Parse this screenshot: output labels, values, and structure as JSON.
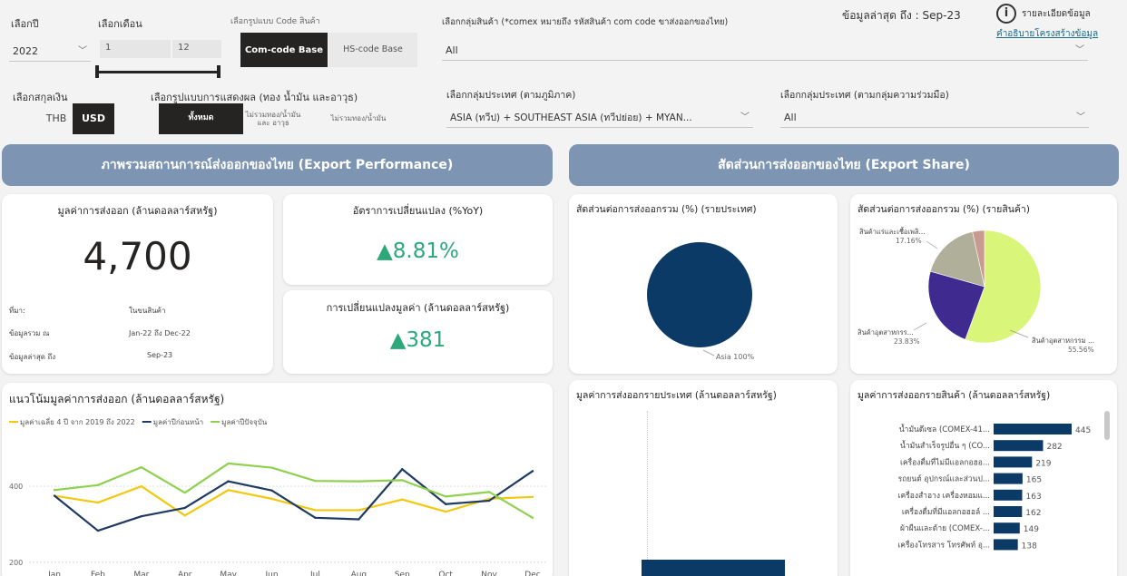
{
  "filters": {
    "year_label": "เลือกปี",
    "year_value": "2022",
    "month_label": "เลือกเดือน",
    "month_from": "1",
    "month_to": "12",
    "code_type_label": "เลือกรูปแบบ Code สินค้า",
    "code_btn_active": "Com-code Base",
    "code_btn_inactive": "HS-code Base",
    "product_group_label": "เลือกกลุ่มสินค้า (*comex หมายถึง รหัสสินค้า com code ขาส่งออกของไทย)",
    "product_group_value": "All",
    "latest_data_label": "ข้อมูลล่าสุด ถึง : Sep-23",
    "detail_label": "รายละเอียดข้อมูล",
    "structure_link": "คำอธิบายโครงสร้างข้อมูล",
    "currency_label": "เลือกสกุลเงิน",
    "currency_thb": "THB",
    "currency_usd": "USD",
    "display_label": "เลือกรูปแบบการแสดงผล (ทอง น้ำมัน และอาวุธ)",
    "display_all": "ทั้งหมด",
    "display_opt2": "ไม่รวมทอง/น้ำมัน และ อาวุธ",
    "display_opt3": "ไม่รวมทอง/น้ำมัน",
    "region_label": "เลือกกลุ่มประเทศ (ตามภูมิภาค)",
    "region_value": "ASIA (ทวีป) + SOUTHEAST ASIA (ทวีปย่อย) + MYAN...",
    "coop_label": "เลือกกลุ่มประเทศ (ตามกลุ่มความร่วมมือ)",
    "coop_value": "All"
  },
  "banners": {
    "performance": "ภาพรวมสถานการณ์ส่งออกของไทย (Export Performance)",
    "share": "สัดส่วนการส่งออกของไทย (Export Share)"
  },
  "export_value": {
    "title": "มูลค่าการส่งออก (ล้านดอลลาร์สหรัฐ)",
    "value": "4,700",
    "source_label": "ที่มา:",
    "source_value": "ในขนสินค้า",
    "range_label": "ข้อมูลรวม ณ",
    "range_value": "Jan-22 ถึง Dec-22",
    "latest_label": "ข้อมูลล่าสุด ถึง",
    "latest_value": "Sep-23"
  },
  "yoy": {
    "title": "อัตราการเปลี่ยนแปลง (%YoY)",
    "value": "▲8.81%"
  },
  "change": {
    "title": "การเปลี่ยนแปลงมูลค่า (ล้านดอลลาร์สหรัฐ)",
    "value": "▲381"
  },
  "share_country": {
    "title": "สัดส่วนต่อการส่งออกรวม (%) (รายประเทศ)",
    "label": "Asia 100%"
  },
  "share_product": {
    "title": "สัดส่วนต่อการส่งออกรวม (%) (รายสินค้า)",
    "slices": [
      {
        "name": "สินค้าอุตสาหกรรม ...",
        "value": 55.56,
        "label": "55.56%",
        "color": "#d9f57a"
      },
      {
        "name": "สินค้าอุตสาหกรร...",
        "value": 23.83,
        "label": "23.83%",
        "color": "#3f2a8f"
      },
      {
        "name": "สินค้าแร่และเชื้อเพลิ...",
        "value": 17.16,
        "label": "17.16%",
        "color": "#b0b09a"
      },
      {
        "name": "",
        "value": 3.45,
        "label": "",
        "color": "#c99a8f"
      }
    ]
  },
  "trend": {
    "title": "แนวโน้มมูลค่าการส่งออก (ล้านดอลลาร์สหรัฐ)",
    "legend": [
      {
        "name": "มูลค่าเฉลี่ย 4 ปี จาก 2019 ถึง 2022",
        "color": "#f2c811"
      },
      {
        "name": "มูลค่าปีก่อนหน้า",
        "color": "#1f3a63"
      },
      {
        "name": "มูลค่าปีปัจจุบัน",
        "color": "#8fd14f"
      }
    ]
  },
  "country_bar": {
    "title": "มูลค่าการส่งออกรายประเทศ (ล้านดอลลาร์สหรัฐ)"
  },
  "product_bar": {
    "title": "มูลค่าการส่งออกรายสินค้า (ล้านดอลลาร์สหรัฐ)"
  },
  "chart_data": [
    {
      "type": "line",
      "title": "แนวโน้มมูลค่าการส่งออก (ล้านดอลลาร์สหรัฐ)",
      "categories": [
        "Jan",
        "Feb",
        "Mar",
        "Apr",
        "May",
        "Jun",
        "Jul",
        "Aug",
        "Sep",
        "Oct",
        "Nov",
        "Dec"
      ],
      "yticks": [
        200,
        400
      ],
      "ylim": [
        190,
        510
      ],
      "series": [
        {
          "name": "มูลค่าเฉลี่ย 4 ปี จาก 2019 ถึง 2022",
          "color": "#f2c811",
          "values": [
            375,
            357,
            400,
            323,
            390,
            367,
            337,
            337,
            365,
            333,
            367,
            372
          ]
        },
        {
          "name": "มูลค่าปีก่อนหน้า",
          "color": "#1f3a63",
          "values": [
            375,
            283,
            321,
            343,
            413,
            389,
            317,
            313,
            445,
            353,
            362,
            440
          ]
        },
        {
          "name": "มูลค่าปีปัจจุบัน",
          "color": "#8fd14f",
          "values": [
            390,
            403,
            450,
            383,
            460,
            449,
            414,
            413,
            416,
            373,
            385,
            317
          ]
        }
      ]
    },
    {
      "type": "bar",
      "title": "มูลค่าการส่งออกรายสินค้า (ล้านดอลลาร์สหรัฐ)",
      "categories": [
        "น้ำมันดีเซล (COMEX-41...",
        "น้ำมันสำเร็จรูปอื่น ๆ (CO...",
        "เครื่องดื่มที่ไม่มีแอลกอฮอ...",
        "รถยนต์ อุปกรณ์และส่วนป...",
        "เครื่องสำอาง เครื่องหอมแ...",
        "เครื่องดื่มที่มีแอลกอฮอล์ ...",
        "ผ้าผืนและด้าย (COMEX-...",
        "เครื่องโทรสาร โทรศัพท์ อุ..."
      ],
      "values": [
        445,
        282,
        219,
        165,
        163,
        162,
        149,
        138
      ],
      "color": "#0b3a66"
    },
    {
      "type": "pie",
      "title": "สัดส่วนต่อการส่งออกรวม (%) (รายสินค้า)",
      "categories": [
        "สินค้าอุตสาหกรรม ...",
        "สินค้าอุตสาหกรร...",
        "สินค้าแร่และเชื้อเพลิ...",
        ""
      ],
      "values": [
        55.56,
        23.83,
        17.16,
        3.45
      ]
    },
    {
      "type": "pie",
      "title": "สัดส่วนต่อการส่งออกรวม (%) (รายประเทศ)",
      "categories": [
        "Asia"
      ],
      "values": [
        100
      ]
    }
  ]
}
